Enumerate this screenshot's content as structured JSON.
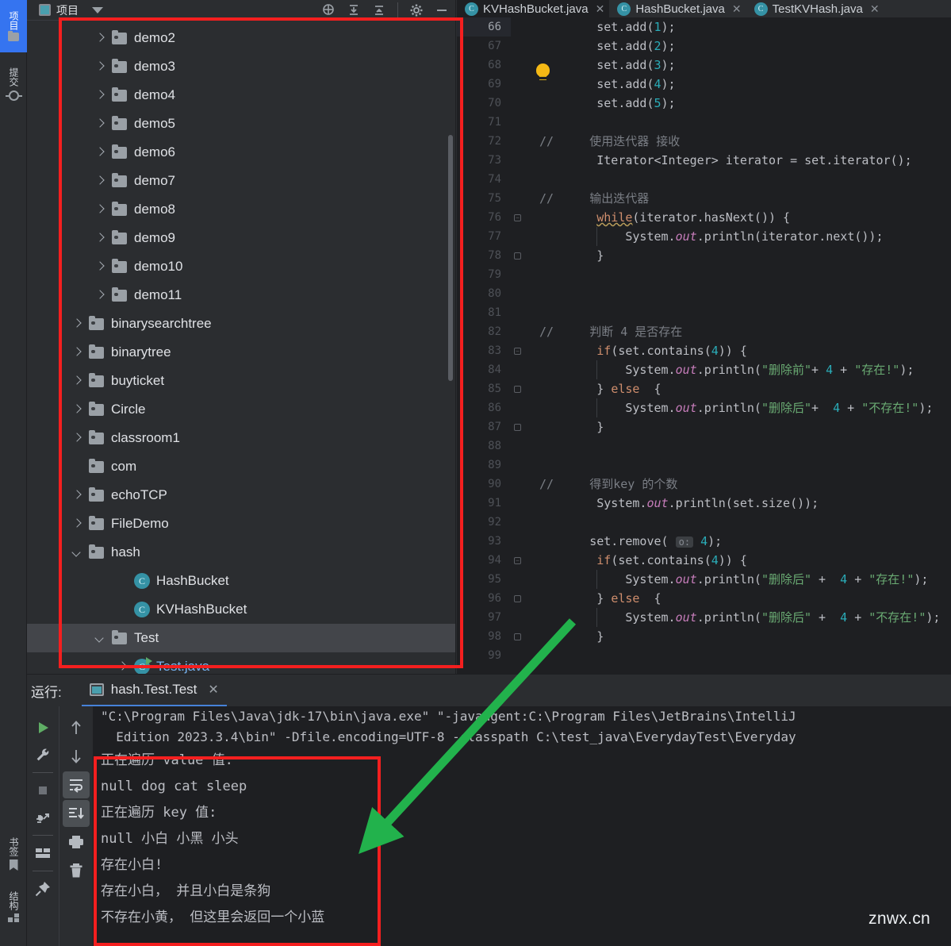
{
  "activity_bar": {
    "items": [
      {
        "label": "项目",
        "icon": "folder-icon",
        "active": true
      },
      {
        "label": "提交",
        "icon": "commit-icon",
        "active": false
      },
      {
        "label": "书签",
        "icon": "bookmark-icon",
        "active": false
      },
      {
        "label": "结构",
        "icon": "structure-icon",
        "active": false
      }
    ]
  },
  "project_panel": {
    "title": "项目",
    "toolbar_icons": [
      "locate-icon",
      "collapse-all-icon",
      "expand-all-icon",
      "settings-gear-icon",
      "minimize-icon"
    ],
    "tree": [
      {
        "label": "demo2",
        "type": "folder",
        "arrow": "right",
        "indent": 113,
        "selected": false
      },
      {
        "label": "demo3",
        "type": "folder",
        "arrow": "right",
        "indent": 113,
        "selected": false
      },
      {
        "label": "demo4",
        "type": "folder",
        "arrow": "right",
        "indent": 113,
        "selected": false
      },
      {
        "label": "demo5",
        "type": "folder",
        "arrow": "right",
        "indent": 113,
        "selected": false
      },
      {
        "label": "demo6",
        "type": "folder",
        "arrow": "right",
        "indent": 113,
        "selected": false
      },
      {
        "label": "demo7",
        "type": "folder",
        "arrow": "right",
        "indent": 113,
        "selected": false
      },
      {
        "label": "demo8",
        "type": "folder",
        "arrow": "right",
        "indent": 113,
        "selected": false
      },
      {
        "label": "demo9",
        "type": "folder",
        "arrow": "right",
        "indent": 113,
        "selected": false
      },
      {
        "label": "demo10",
        "type": "folder",
        "arrow": "right",
        "indent": 113,
        "selected": false
      },
      {
        "label": "demo11",
        "type": "folder",
        "arrow": "right",
        "indent": 113,
        "selected": false
      },
      {
        "label": "binarysearchtree",
        "type": "folder",
        "arrow": "right",
        "indent": 84,
        "selected": false
      },
      {
        "label": "binarytree",
        "type": "folder",
        "arrow": "right",
        "indent": 84,
        "selected": false
      },
      {
        "label": "buyticket",
        "type": "folder",
        "arrow": "right",
        "indent": 84,
        "selected": false
      },
      {
        "label": "Circle",
        "type": "folder",
        "arrow": "right",
        "indent": 84,
        "selected": false
      },
      {
        "label": "classroom1",
        "type": "folder",
        "arrow": "right",
        "indent": 84,
        "selected": false
      },
      {
        "label": "com",
        "type": "folder",
        "arrow": "none",
        "indent": 84,
        "selected": false
      },
      {
        "label": "echoTCP",
        "type": "folder",
        "arrow": "right",
        "indent": 84,
        "selected": false
      },
      {
        "label": "FileDemo",
        "type": "folder",
        "arrow": "right",
        "indent": 84,
        "selected": false
      },
      {
        "label": "hash",
        "type": "folder",
        "arrow": "down",
        "indent": 84,
        "selected": false
      },
      {
        "label": "HashBucket",
        "type": "class",
        "arrow": "none",
        "indent": 141,
        "selected": false
      },
      {
        "label": "KVHashBucket",
        "type": "class",
        "arrow": "none",
        "indent": 141,
        "selected": false
      },
      {
        "label": "Test",
        "type": "folder",
        "arrow": "down",
        "indent": 113,
        "selected": true
      },
      {
        "label": "Test.java",
        "type": "class-run",
        "arrow": "right",
        "indent": 141,
        "selected": false
      }
    ]
  },
  "editor": {
    "tabs": [
      {
        "label": "KVHashBucket.java",
        "active": true,
        "closable": true
      },
      {
        "label": "HashBucket.java",
        "active": false,
        "closable": true
      },
      {
        "label": "TestKVHash.java",
        "active": false,
        "closable": true
      }
    ],
    "first_line_number": 66,
    "current_line": 66,
    "lines": [
      {
        "n": 66,
        "segs": [
          {
            "t": "        set.add(",
            "c": "plain"
          },
          {
            "t": "1",
            "c": "num"
          },
          {
            "t": ");",
            "c": "plain"
          }
        ]
      },
      {
        "n": 67,
        "segs": [
          {
            "t": "        set.add(",
            "c": "plain"
          },
          {
            "t": "2",
            "c": "num"
          },
          {
            "t": ");",
            "c": "plain"
          }
        ]
      },
      {
        "n": 68,
        "segs": [
          {
            "t": "        set.add(",
            "c": "plain"
          },
          {
            "t": "3",
            "c": "num"
          },
          {
            "t": ");",
            "c": "plain"
          }
        ]
      },
      {
        "n": 69,
        "segs": [
          {
            "t": "        set.add(",
            "c": "plain"
          },
          {
            "t": "4",
            "c": "num"
          },
          {
            "t": ");",
            "c": "plain"
          }
        ]
      },
      {
        "n": 70,
        "segs": [
          {
            "t": "        set.add(",
            "c": "plain"
          },
          {
            "t": "5",
            "c": "num"
          },
          {
            "t": ");",
            "c": "plain"
          }
        ]
      },
      {
        "n": 71,
        "segs": []
      },
      {
        "n": 72,
        "segs": [
          {
            "t": "//     使用迭代器 接收",
            "c": "cmt"
          }
        ]
      },
      {
        "n": 73,
        "segs": [
          {
            "t": "        Iterator<Integer> iterator = set.iterator();",
            "c": "plain"
          }
        ]
      },
      {
        "n": 74,
        "segs": []
      },
      {
        "n": 75,
        "segs": [
          {
            "t": "//     输出迭代器",
            "c": "cmt"
          }
        ]
      },
      {
        "n": 76,
        "segs": [
          {
            "t": "        ",
            "c": "plain"
          },
          {
            "t": "while",
            "c": "kw-sq"
          },
          {
            "t": "(iterator.hasNext()) {",
            "c": "plain"
          }
        ]
      },
      {
        "n": 77,
        "segs": [
          {
            "t": "            System.",
            "c": "plain"
          },
          {
            "t": "out",
            "c": "fld"
          },
          {
            "t": ".println(iterator.next());",
            "c": "plain"
          }
        ]
      },
      {
        "n": 78,
        "segs": [
          {
            "t": "        }",
            "c": "plain"
          }
        ]
      },
      {
        "n": 79,
        "segs": []
      },
      {
        "n": 80,
        "segs": []
      },
      {
        "n": 81,
        "segs": []
      },
      {
        "n": 82,
        "segs": [
          {
            "t": "//     判断 4 是否存在",
            "c": "cmt"
          }
        ]
      },
      {
        "n": 83,
        "segs": [
          {
            "t": "        ",
            "c": "plain"
          },
          {
            "t": "if",
            "c": "kw"
          },
          {
            "t": "(set.contains(",
            "c": "plain"
          },
          {
            "t": "4",
            "c": "num"
          },
          {
            "t": ")) {",
            "c": "plain"
          }
        ]
      },
      {
        "n": 84,
        "segs": [
          {
            "t": "            System.",
            "c": "plain"
          },
          {
            "t": "out",
            "c": "fld"
          },
          {
            "t": ".println(",
            "c": "plain"
          },
          {
            "t": "\"删除前\"",
            "c": "str"
          },
          {
            "t": "+ ",
            "c": "plain"
          },
          {
            "t": "4",
            "c": "num"
          },
          {
            "t": " + ",
            "c": "plain"
          },
          {
            "t": "\"存在!\"",
            "c": "str"
          },
          {
            "t": ");",
            "c": "plain"
          }
        ]
      },
      {
        "n": 85,
        "segs": [
          {
            "t": "        } ",
            "c": "plain"
          },
          {
            "t": "else",
            "c": "kw"
          },
          {
            "t": "  {",
            "c": "plain"
          }
        ]
      },
      {
        "n": 86,
        "segs": [
          {
            "t": "            System.",
            "c": "plain"
          },
          {
            "t": "out",
            "c": "fld"
          },
          {
            "t": ".println(",
            "c": "plain"
          },
          {
            "t": "\"删除后\"",
            "c": "str"
          },
          {
            "t": "+  ",
            "c": "plain"
          },
          {
            "t": "4",
            "c": "num"
          },
          {
            "t": " + ",
            "c": "plain"
          },
          {
            "t": "\"不存在!\"",
            "c": "str"
          },
          {
            "t": ");",
            "c": "plain"
          }
        ]
      },
      {
        "n": 87,
        "segs": [
          {
            "t": "        }",
            "c": "plain"
          }
        ]
      },
      {
        "n": 88,
        "segs": []
      },
      {
        "n": 89,
        "segs": []
      },
      {
        "n": 90,
        "segs": [
          {
            "t": "//     得到key 的个数",
            "c": "cmt"
          }
        ]
      },
      {
        "n": 91,
        "segs": [
          {
            "t": "        System.",
            "c": "plain"
          },
          {
            "t": "out",
            "c": "fld"
          },
          {
            "t": ".println(set.size());",
            "c": "plain"
          }
        ]
      },
      {
        "n": 92,
        "segs": []
      },
      {
        "n": 93,
        "segs": [
          {
            "t": "       set.remove( ",
            "c": "plain"
          },
          {
            "t": "o:",
            "c": "hint"
          },
          {
            "t": " ",
            "c": "plain"
          },
          {
            "t": "4",
            "c": "num"
          },
          {
            "t": ");",
            "c": "plain"
          }
        ]
      },
      {
        "n": 94,
        "segs": [
          {
            "t": "        ",
            "c": "plain"
          },
          {
            "t": "if",
            "c": "kw"
          },
          {
            "t": "(set.contains(",
            "c": "plain"
          },
          {
            "t": "4",
            "c": "num"
          },
          {
            "t": ")) {",
            "c": "plain"
          }
        ]
      },
      {
        "n": 95,
        "segs": [
          {
            "t": "            System.",
            "c": "plain"
          },
          {
            "t": "out",
            "c": "fld"
          },
          {
            "t": ".println(",
            "c": "plain"
          },
          {
            "t": "\"删除后\"",
            "c": "str"
          },
          {
            "t": " +  ",
            "c": "plain"
          },
          {
            "t": "4",
            "c": "num"
          },
          {
            "t": " + ",
            "c": "plain"
          },
          {
            "t": "\"存在!\"",
            "c": "str"
          },
          {
            "t": ");",
            "c": "plain"
          }
        ]
      },
      {
        "n": 96,
        "segs": [
          {
            "t": "        } ",
            "c": "plain"
          },
          {
            "t": "else",
            "c": "kw"
          },
          {
            "t": "  {",
            "c": "plain"
          }
        ]
      },
      {
        "n": 97,
        "segs": [
          {
            "t": "            System.",
            "c": "plain"
          },
          {
            "t": "out",
            "c": "fld"
          },
          {
            "t": ".println(",
            "c": "plain"
          },
          {
            "t": "\"删除后\"",
            "c": "str"
          },
          {
            "t": " +  ",
            "c": "plain"
          },
          {
            "t": "4",
            "c": "num"
          },
          {
            "t": " + ",
            "c": "plain"
          },
          {
            "t": "\"不存在!\"",
            "c": "str"
          },
          {
            "t": ");",
            "c": "plain"
          }
        ]
      },
      {
        "n": 98,
        "segs": [
          {
            "t": "        }",
            "c": "plain"
          }
        ]
      },
      {
        "n": 99,
        "segs": []
      }
    ]
  },
  "run_panel": {
    "label": "运行:",
    "tab_name": "hash.Test.Test",
    "toolbar_left": [
      "run-icon",
      "wrench-icon",
      "stop-icon",
      "rerun-failed-icon",
      "layout-icon",
      "pin-icon"
    ],
    "toolbar_right": [
      "arrow-up-icon",
      "arrow-down-icon",
      "soft-wrap-icon",
      "scroll-to-end-icon",
      "print-icon",
      "trash-icon"
    ],
    "command_lines": [
      "\"C:\\Program Files\\Java\\jdk-17\\bin\\java.exe\" \"-javaagent:C:\\Program Files\\JetBrains\\IntelliJ",
      "  Edition 2023.3.4\\bin\" -Dfile.encoding=UTF-8 -classpath C:\\test_java\\EverydayTest\\Everyday"
    ],
    "output_lines": [
      "正在遍历 value 值:",
      "null dog cat sleep",
      "正在遍历 key 值:",
      "null 小白 小黑 小头",
      "存在小白!",
      "存在小白， 并且小白是条狗",
      "不存在小黄， 但这里会返回一个小蓝"
    ]
  },
  "annotations": {
    "highlight_color": "#f41f1f",
    "arrow_color": "#22b24c",
    "watermark": "znwx.cn"
  }
}
